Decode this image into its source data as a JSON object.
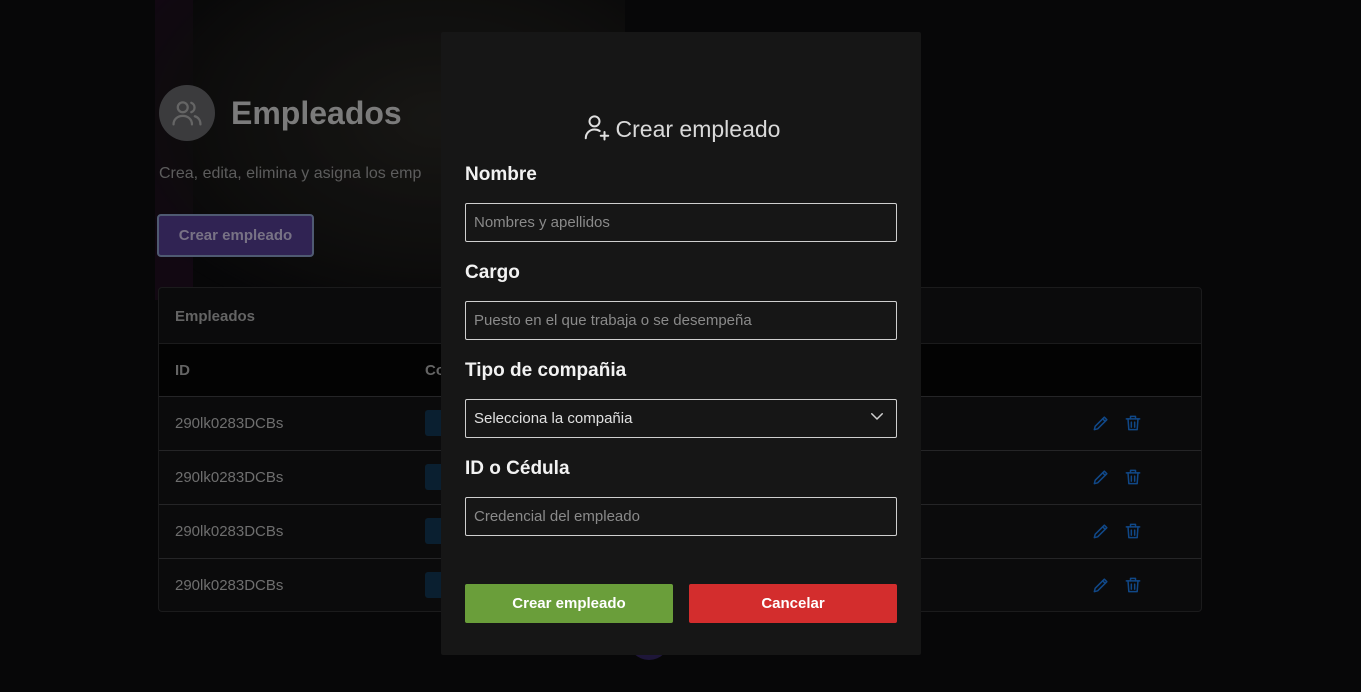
{
  "page": {
    "title": "Empleados",
    "subtitle": "Crea, edita, elimina y asigna los emp",
    "create_button": "Crear empleado",
    "table": {
      "card_title": "Empleados",
      "columns": [
        "ID",
        "Co"
      ],
      "rows": [
        {
          "id": "290lk0283DCBs"
        },
        {
          "id": "290lk0283DCBs"
        },
        {
          "id": "290lk0283DCBs"
        },
        {
          "id": "290lk0283DCBs"
        }
      ]
    },
    "colors": {
      "action_icon": "#1a6fd1",
      "create_button_bg": "#4a3680"
    }
  },
  "modal": {
    "icon": "user-plus-icon",
    "title": "Crear empleado",
    "fields": {
      "nombre": {
        "label": "Nombre",
        "placeholder": "Nombres y apellidos",
        "value": ""
      },
      "cargo": {
        "label": "Cargo",
        "placeholder": "Puesto en el que trabaja o se desempeña",
        "value": ""
      },
      "compania": {
        "label": "Tipo de compañia",
        "selected": "Selecciona la compañia",
        "icon": "chevron-down-icon"
      },
      "cedula": {
        "label": "ID o Cédula",
        "placeholder": "Credencial del empleado",
        "value": ""
      }
    },
    "buttons": {
      "create": "Crear empleado",
      "cancel": "Cancelar"
    },
    "colors": {
      "create_bg": "#6a9e3a",
      "cancel_bg": "#d32d2d",
      "modal_bg": "#161616"
    }
  }
}
